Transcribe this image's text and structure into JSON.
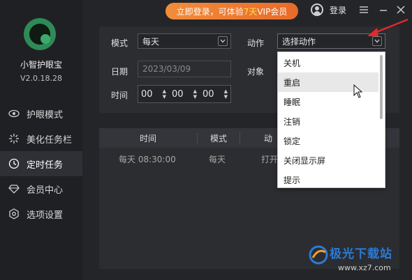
{
  "app": {
    "name": "小智护眼宝",
    "version": "V2.0.18.28"
  },
  "sidebar": {
    "items": [
      {
        "label": "护眼模式",
        "icon": "eye-icon",
        "active": false
      },
      {
        "label": "美化任务栏",
        "icon": "sparkle-icon",
        "active": false
      },
      {
        "label": "定时任务",
        "icon": "clock-icon",
        "active": true
      },
      {
        "label": "会员中心",
        "icon": "diamond-icon",
        "active": false
      },
      {
        "label": "选项设置",
        "icon": "settings-icon",
        "active": false
      }
    ]
  },
  "header": {
    "vip_prefix": "立即登录，可体验",
    "vip_highlight": "7天",
    "vip_suffix": "VIP会员",
    "login_label": "登录"
  },
  "form": {
    "mode_label": "模式",
    "mode_value": "每天",
    "action_label": "动作",
    "action_value": "选择动作",
    "date_label": "日期",
    "date_value": "2023/03/09",
    "target_label": "对象",
    "time_label": "时间",
    "hour": "00",
    "minute": "00",
    "second": "00"
  },
  "table": {
    "headers": [
      "时间",
      "模式",
      "动"
    ],
    "rows": [
      {
        "time": "每天 08:30:00",
        "mode": "每天",
        "action": "打开"
      }
    ]
  },
  "dropdown": {
    "options": [
      "关机",
      "重启",
      "睡眠",
      "注销",
      "锁定",
      "关闭显示屏",
      "提示"
    ],
    "hovered_index": 1
  },
  "watermark": {
    "title": "极光下载站",
    "url": "www.xz7.com"
  },
  "colors": {
    "accent_orange": "#e86a2a",
    "brand_green": "#2e8b57",
    "arrow_red": "#e02a2a",
    "watermark_blue": "#2a7bd6"
  }
}
